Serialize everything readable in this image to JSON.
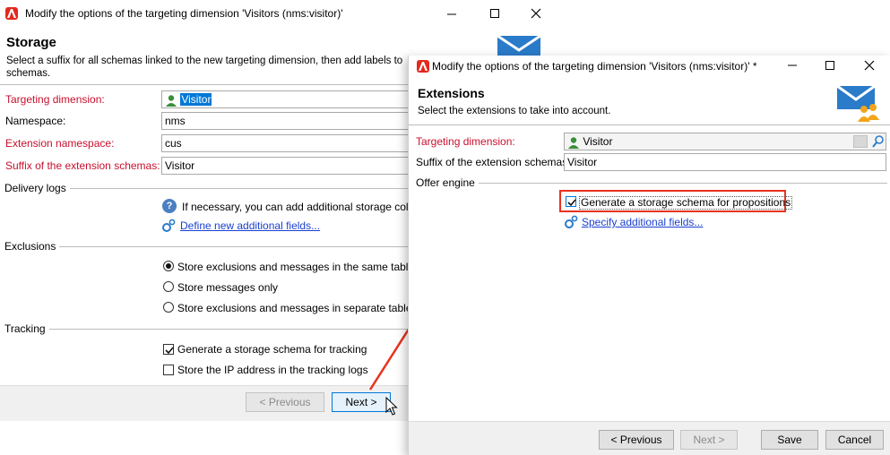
{
  "back_window": {
    "title": "Modify the options of the targeting dimension 'Visitors (nms:visitor)'",
    "header": {
      "title": "Storage",
      "description": "Select a suffix for all schemas linked to the new targeting dimension, then add labels to schemas."
    },
    "fields": {
      "targeting_dimension_label": "Targeting dimension:",
      "targeting_dimension_value": "Visitor",
      "namespace_label": "Namespace:",
      "namespace_value": "nms",
      "extension_namespace_label": "Extension namespace:",
      "extension_namespace_value": "cus",
      "suffix_label": "Suffix of the extension schemas:",
      "suffix_value": "Visitor"
    },
    "delivery_logs": {
      "section_label": "Delivery logs",
      "info_text": "If necessary, you can add additional storage columns",
      "link": "Define new additional fields..."
    },
    "exclusions": {
      "section_label": "Exclusions",
      "options": [
        {
          "label": "Store exclusions and messages in the same table",
          "selected": true
        },
        {
          "label": "Store messages only",
          "selected": false
        },
        {
          "label": "Store exclusions and messages in separate tables",
          "selected": false
        }
      ]
    },
    "tracking": {
      "section_label": "Tracking",
      "generate_label": "Generate a storage schema for tracking",
      "generate_checked": true,
      "ip_label": "Store the IP address in the tracking logs",
      "ip_checked": false
    },
    "buttons": {
      "previous": "< Previous",
      "next": "Next >"
    }
  },
  "front_window": {
    "title": "Modify the options of the targeting dimension 'Visitors (nms:visitor)' *",
    "header": {
      "title": "Extensions",
      "description": "Select the extensions to take into account."
    },
    "fields": {
      "targeting_dimension_label": "Targeting dimension:",
      "targeting_dimension_value": "Visitor",
      "suffix_label": "Suffix of the extension schemas:",
      "suffix_value": "Visitor"
    },
    "offer_engine": {
      "section_label": "Offer engine",
      "generate_label": "Generate a storage schema for propositions",
      "generate_checked": true,
      "link": "Specify additional fields..."
    },
    "buttons": {
      "previous": "< Previous",
      "next": "Next >",
      "save": "Save",
      "cancel": "Cancel"
    }
  },
  "colors": {
    "required_label": "#c8102e",
    "link": "#1a3fd0",
    "highlight_box": "#e8321d",
    "arrow": "#e8321d",
    "brand_icon": "#e3281d",
    "mail_icon": "#2a7bc9"
  }
}
